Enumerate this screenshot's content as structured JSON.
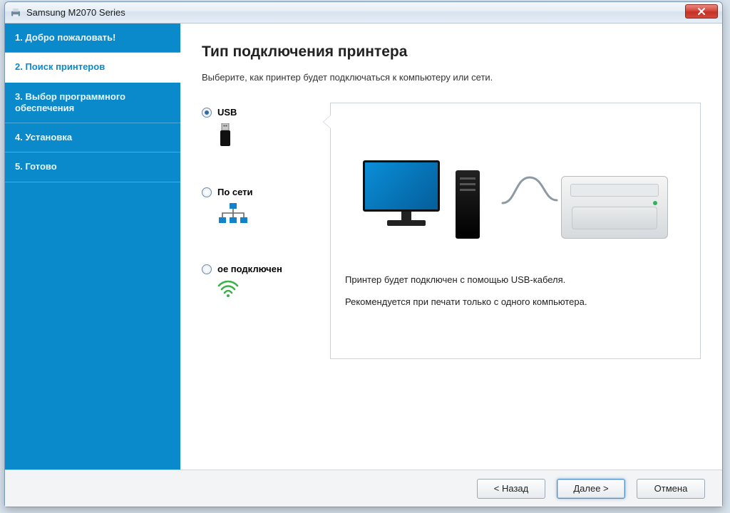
{
  "window": {
    "title": "Samsung M2070 Series"
  },
  "sidebar": {
    "items": [
      {
        "label": "1. Добро пожаловать!"
      },
      {
        "label": "2. Поиск принтеров"
      },
      {
        "label": "3. Выбор программного обеспечения"
      },
      {
        "label": "4. Установка"
      },
      {
        "label": "5. Готово"
      }
    ],
    "active_index": 1
  },
  "main": {
    "title": "Тип подключения принтера",
    "subtitle": "Выберите, как принтер будет подключаться к компьютеру или сети.",
    "options": [
      {
        "label": "USB",
        "checked": true
      },
      {
        "label": "По сети",
        "checked": false
      },
      {
        "label": "ое подключен",
        "checked": false
      }
    ],
    "description": {
      "line1": "Принтер будет подключен с помощью USB-кабеля.",
      "line2": "Рекомендуется при печати только с одного компьютера."
    }
  },
  "footer": {
    "back": "< Назад",
    "next": "Далее >",
    "cancel": "Отмена"
  }
}
